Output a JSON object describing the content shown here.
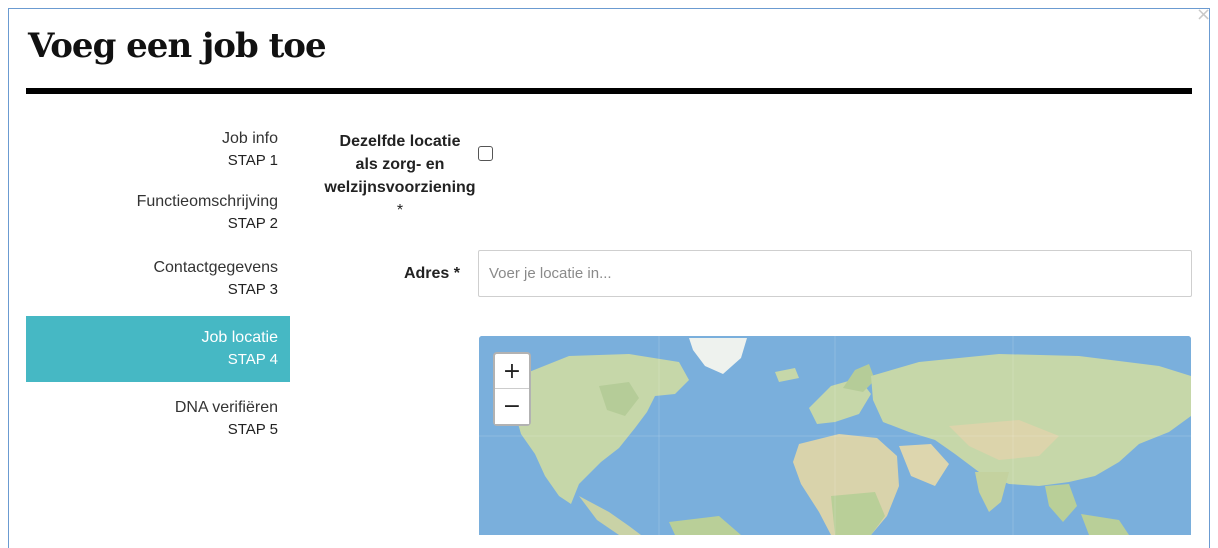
{
  "modal": {
    "title": "Voeg een job toe",
    "close_glyph": "×"
  },
  "steps": [
    {
      "label": "Job info",
      "step": "STAP 1",
      "active": false
    },
    {
      "label": "Functieomschrijving",
      "step": "STAP 2",
      "active": false
    },
    {
      "label": "Contactgegevens",
      "step": "STAP 3",
      "active": false
    },
    {
      "label": "Job locatie",
      "step": "STAP 4",
      "active": true
    },
    {
      "label": "DNA verifiëren",
      "step": "STAP 5",
      "active": false
    }
  ],
  "form": {
    "same_location_label_line1": "Dezelfde locatie",
    "same_location_label_line2": "als zorg- en",
    "same_location_label_line3": "welzijnsvoorziening",
    "same_location_required": "*",
    "same_location_checked": false,
    "address_label": "Adres *",
    "address_value": "",
    "address_placeholder": "Voer je locatie in..."
  },
  "map": {
    "zoom_in": "+",
    "zoom_out": "−",
    "water_color": "#7aafdc",
    "land_color": "#c6d7a9"
  },
  "colors": {
    "active_step": "#46b8c4",
    "title_rule": "#000000"
  }
}
